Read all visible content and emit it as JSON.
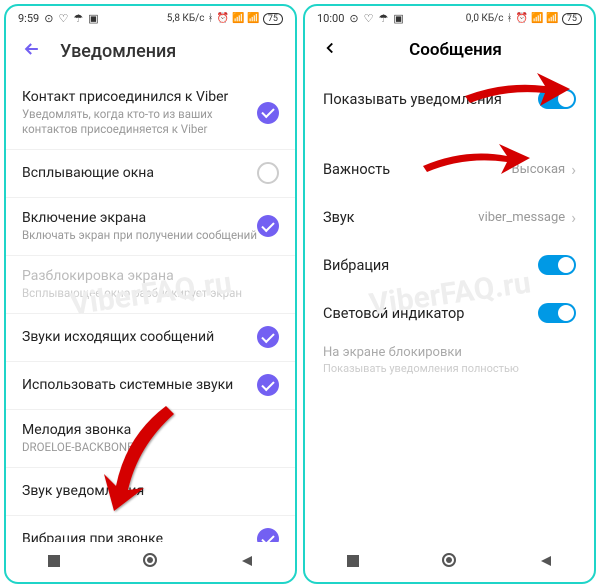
{
  "watermark": "ViberFAQ.ru",
  "left": {
    "statusbar": {
      "time": "9:59",
      "data": "5,8 КБ/с",
      "battery": "75"
    },
    "header": {
      "title": "Уведомления"
    },
    "rows": [
      {
        "title": "Контакт присоединился к Viber",
        "sub": "Уведомлять, когда кто-то из ваших контактов присоединяется к Viber",
        "checked": true
      },
      {
        "title": "Всплывающие окна",
        "sub": "",
        "checked": false
      },
      {
        "title": "Включение экрана",
        "sub": "Включать экран при получении сообщений",
        "checked": true
      },
      {
        "title": "Разблокировка экрана",
        "sub": "Всплывающее окно разблокирует экран",
        "disabled": true
      },
      {
        "title": "Звуки исходящих сообщений",
        "sub": "",
        "checked": true
      },
      {
        "title": "Использовать системные звуки",
        "sub": "",
        "checked": true
      },
      {
        "title": "Мелодия звонка",
        "sub": "DROELOE-BACKBONE"
      },
      {
        "title": "Звук уведомления",
        "sub": ""
      },
      {
        "title": "Вибрация при звонке",
        "sub": "",
        "checked": true
      }
    ]
  },
  "right": {
    "statusbar": {
      "time": "10:00",
      "data": "0,0 КБ/с",
      "battery": "75"
    },
    "header": {
      "title": "Сообщения"
    },
    "rows": [
      {
        "title": "Показывать уведомления",
        "type": "toggle"
      },
      {
        "title": "Важность",
        "value": "Высокая",
        "type": "link"
      },
      {
        "title": "Звук",
        "value": "viber_message",
        "type": "link"
      },
      {
        "title": "Вибрация",
        "type": "toggle"
      },
      {
        "title": "Световой индикатор",
        "type": "toggle"
      }
    ],
    "footer": {
      "title": "На экране блокировки",
      "sub": "Показывать уведомления полностью"
    }
  }
}
